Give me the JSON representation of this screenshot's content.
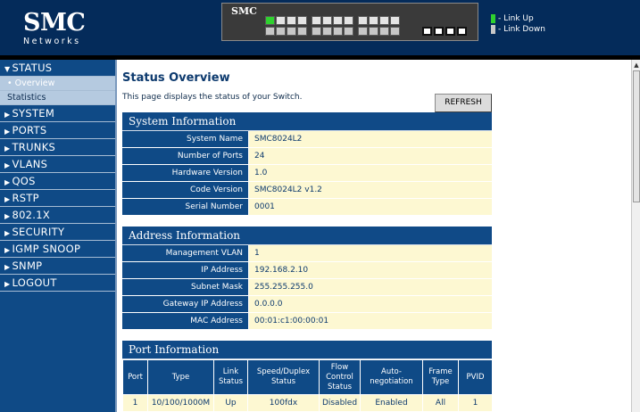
{
  "header": {
    "logo_main": "SMC",
    "logo_sub": "Networks",
    "switch_label": "SMC",
    "legend": [
      {
        "label": "- Link Up",
        "color": "#2fd12f"
      },
      {
        "label": "- Link Down",
        "color": "#c8c8c8"
      }
    ],
    "port_status": "port 1 up, ports 2-24 down"
  },
  "sidebar": {
    "items": [
      {
        "label": "STATUS",
        "icon": "triangle-down-icon",
        "open": true
      },
      {
        "label": "SYSTEM",
        "icon": "triangle-right-icon"
      },
      {
        "label": "PORTS",
        "icon": "triangle-right-icon"
      },
      {
        "label": "TRUNKS",
        "icon": "triangle-right-icon"
      },
      {
        "label": "VLANS",
        "icon": "triangle-right-icon"
      },
      {
        "label": "QOS",
        "icon": "triangle-right-icon"
      },
      {
        "label": "RSTP",
        "icon": "triangle-right-icon"
      },
      {
        "label": "802.1X",
        "icon": "triangle-right-icon"
      },
      {
        "label": "SECURITY",
        "icon": "triangle-right-icon"
      },
      {
        "label": "IGMP SNOOP",
        "icon": "triangle-right-icon"
      },
      {
        "label": "SNMP",
        "icon": "triangle-right-icon"
      },
      {
        "label": "LOGOUT",
        "icon": "triangle-right-icon"
      }
    ],
    "sub_items": [
      {
        "label": "• Overview",
        "active": true
      },
      {
        "label": "Statistics",
        "active": false
      }
    ]
  },
  "main": {
    "title": "Status Overview",
    "description": "This page displays the status of your Switch.",
    "refresh_label": "REFRESH"
  },
  "system_info": {
    "title": "System Information",
    "rows": [
      {
        "label": "System Name",
        "value": "SMC8024L2"
      },
      {
        "label": "Number of Ports",
        "value": "24"
      },
      {
        "label": "Hardware Version",
        "value": "1.0"
      },
      {
        "label": "Code Version",
        "value": "SMC8024L2 v1.2"
      },
      {
        "label": "Serial Number",
        "value": "0001"
      }
    ]
  },
  "address_info": {
    "title": "Address Information",
    "rows": [
      {
        "label": "Management VLAN",
        "value": "1"
      },
      {
        "label": "IP Address",
        "value": "192.168.2.10"
      },
      {
        "label": "Subnet Mask",
        "value": "255.255.255.0"
      },
      {
        "label": "Gateway IP Address",
        "value": "0.0.0.0"
      },
      {
        "label": "MAC Address",
        "value": "00:01:c1:00:00:01"
      }
    ]
  },
  "port_info": {
    "title": "Port Information",
    "headers": [
      "Port",
      "Type",
      "Link Status",
      "Speed/Duplex Status",
      "Flow Control Status",
      "Auto-negotiation",
      "Frame Type",
      "PVID"
    ],
    "rows": [
      [
        "1",
        "10/100/1000M",
        "Up",
        "100fdx",
        "Disabled",
        "Enabled",
        "All",
        "1"
      ]
    ]
  }
}
